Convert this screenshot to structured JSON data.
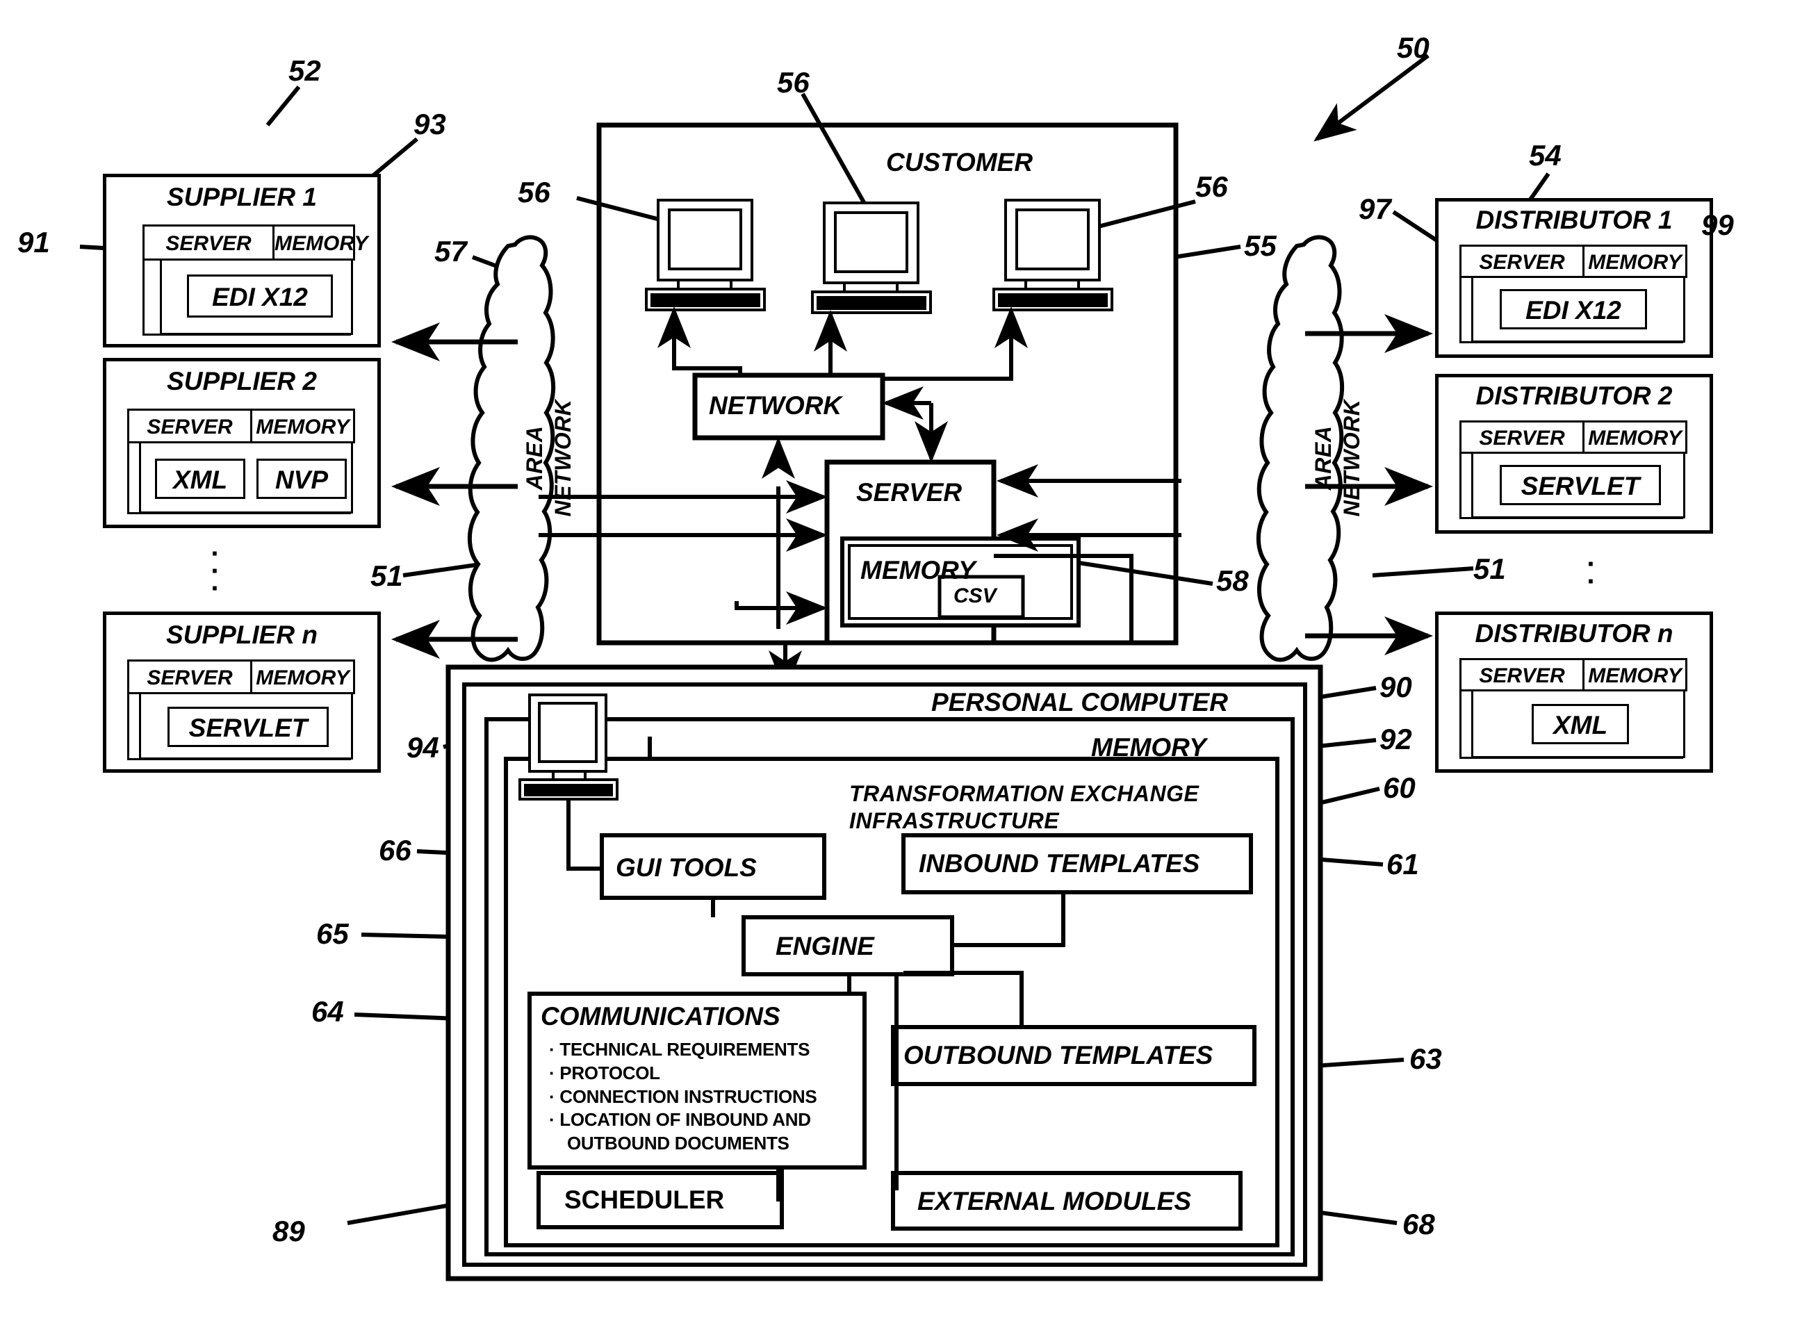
{
  "figure": {
    "system_ref": "50",
    "title_refs": [
      "50",
      "51",
      "52",
      "54",
      "55",
      "56",
      "57",
      "58",
      "60",
      "61",
      "63",
      "64",
      "65",
      "66",
      "68",
      "89",
      "90",
      "91",
      "92",
      "93",
      "94",
      "97",
      "99"
    ]
  },
  "left_column": {
    "ref": "52",
    "nodes": [
      {
        "title": "SUPPLIER 1",
        "server": "SERVER",
        "memory": "MEMORY",
        "formats": [
          "EDI X12"
        ],
        "ref_server": "91",
        "ref_memory": "93"
      },
      {
        "title": "SUPPLIER 2",
        "server": "SERVER",
        "memory": "MEMORY",
        "formats": [
          "XML",
          "NVP"
        ]
      },
      {
        "title": "SUPPLIER n",
        "server": "SERVER",
        "memory": "MEMORY",
        "formats": [
          "SERVLET"
        ]
      }
    ],
    "ellipsis": "·\n·\n·"
  },
  "right_column": {
    "ref": "54",
    "nodes": [
      {
        "title": "DISTRIBUTOR 1",
        "server": "SERVER",
        "memory": "MEMORY",
        "formats": [
          "EDI X12"
        ],
        "ref_server": "97",
        "ref_memory": "99"
      },
      {
        "title": "DISTRIBUTOR 2",
        "server": "SERVER",
        "memory": "MEMORY",
        "formats": [
          "SERVLET"
        ]
      },
      {
        "title": "DISTRIBUTOR n",
        "server": "SERVER",
        "memory": "MEMORY",
        "formats": [
          "XML"
        ]
      }
    ]
  },
  "clouds": {
    "left": {
      "line1": "AREA",
      "line2": "NETWORK",
      "ref": "51"
    },
    "right": {
      "line1": "AREA",
      "line2": "NETWORK",
      "ref": "51"
    }
  },
  "customer": {
    "title": "CUSTOMER",
    "ref": "55",
    "workstation_ref": "56",
    "workstations": 3,
    "network_box": {
      "label": "NETWORK",
      "ref": "57"
    },
    "server_box": {
      "label": "SERVER"
    },
    "memory_box": {
      "label": "MEMORY",
      "ref": "58"
    },
    "csv_box": {
      "label": "CSV"
    }
  },
  "pc": {
    "title": "PERSONAL COMPUTER",
    "ref": "90",
    "memory_title": "MEMORY",
    "memory_ref": "92",
    "tei_line1": "TRANSFORMATION EXCHANGE",
    "tei_line2": "INFRASTRUCTURE",
    "tei_ref": "60",
    "workstation_ref": "94",
    "blocks": {
      "gui_tools": {
        "label": "GUI TOOLS",
        "ref": "66"
      },
      "inbound_templates": {
        "label": "INBOUND TEMPLATES",
        "ref": "61"
      },
      "engine": {
        "label": "ENGINE",
        "ref": "65"
      },
      "communications": {
        "label": "COMMUNICATIONS",
        "ref": "64",
        "items": [
          "· TECHNICAL REQUIREMENTS",
          "· PROTOCOL",
          "· CONNECTION INSTRUCTIONS",
          "· LOCATION OF INBOUND AND",
          "  OUTBOUND DOCUMENTS"
        ]
      },
      "outbound_templates": {
        "label": "OUTBOUND TEMPLATES",
        "ref": "63"
      },
      "external_modules": {
        "label": "EXTERNAL MODULES",
        "ref": "68"
      },
      "scheduler": {
        "label": "SCHEDULER",
        "ref": "89"
      }
    }
  },
  "colors": {
    "ink": "#000000",
    "paper": "#ffffff"
  }
}
